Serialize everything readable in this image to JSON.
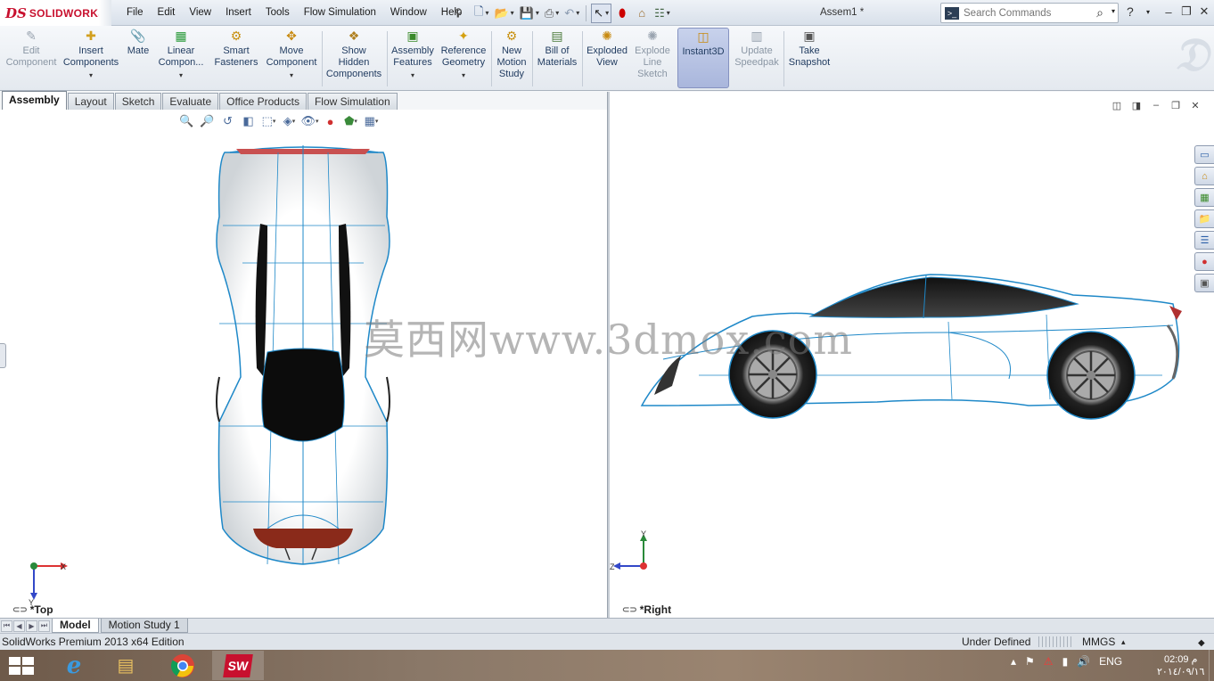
{
  "app": {
    "logo_text": "SOLIDWORKS",
    "logo_mark": "DS",
    "document_title": "Assem1 *"
  },
  "menu": [
    "File",
    "Edit",
    "View",
    "Insert",
    "Tools",
    "Flow Simulation",
    "Window",
    "Help"
  ],
  "search": {
    "placeholder": "Search Commands"
  },
  "ribbon": {
    "buttons": [
      {
        "label": "Edit\nComponent",
        "icon": "edit-component-icon",
        "disabled": true
      },
      {
        "label": "Insert\nComponents",
        "icon": "insert-components-icon",
        "dropdown": true
      },
      {
        "label": "Mate",
        "icon": "mate-icon"
      },
      {
        "label": "Linear\nCompon...",
        "icon": "linear-pattern-icon",
        "dropdown": true
      },
      {
        "label": "Smart\nFasteners",
        "icon": "smart-fasteners-icon"
      },
      {
        "label": "Move\nComponent",
        "icon": "move-component-icon",
        "dropdown": true
      },
      {
        "label": "Show\nHidden\nComponents",
        "icon": "show-hidden-icon"
      },
      {
        "label": "Assembly\nFeatures",
        "icon": "assembly-features-icon",
        "dropdown": true
      },
      {
        "label": "Reference\nGeometry",
        "icon": "reference-geometry-icon",
        "dropdown": true
      },
      {
        "label": "New\nMotion\nStudy",
        "icon": "motion-study-icon"
      },
      {
        "label": "Bill of\nMaterials",
        "icon": "bom-icon"
      },
      {
        "label": "Exploded\nView",
        "icon": "exploded-view-icon"
      },
      {
        "label": "Explode\nLine\nSketch",
        "icon": "explode-line-icon",
        "disabled": true
      },
      {
        "label": "Instant3D",
        "icon": "instant3d-icon",
        "active": true
      },
      {
        "label": "Update\nSpeedpak",
        "icon": "speedpak-icon",
        "disabled": true
      },
      {
        "label": "Take\nSnapshot",
        "icon": "snapshot-icon"
      }
    ]
  },
  "tabs": [
    "Assembly",
    "Layout",
    "Sketch",
    "Evaluate",
    "Office Products",
    "Flow Simulation"
  ],
  "viewports": {
    "left_label": "*Top",
    "right_label": "*Right"
  },
  "triad_left": {
    "x": "X",
    "y": "Y"
  },
  "triad_right": {
    "y": "Y",
    "z": "Z"
  },
  "watermark": "莫西网www.3dmox.com",
  "bottom_tabs": [
    "Model",
    "Motion Study 1"
  ],
  "status": {
    "edition": "SolidWorks Premium 2013 x64 Edition",
    "state": "Under Defined",
    "units": "MMGS"
  },
  "taskbar": {
    "lang": "ENG",
    "time": "02:09 م",
    "date": "٢٠١٤/٠٩/١٦"
  },
  "colors": {
    "brand_red": "#c8102e",
    "edge_blue": "#1e88c8",
    "ribbon_active": "#a9b6dc"
  }
}
